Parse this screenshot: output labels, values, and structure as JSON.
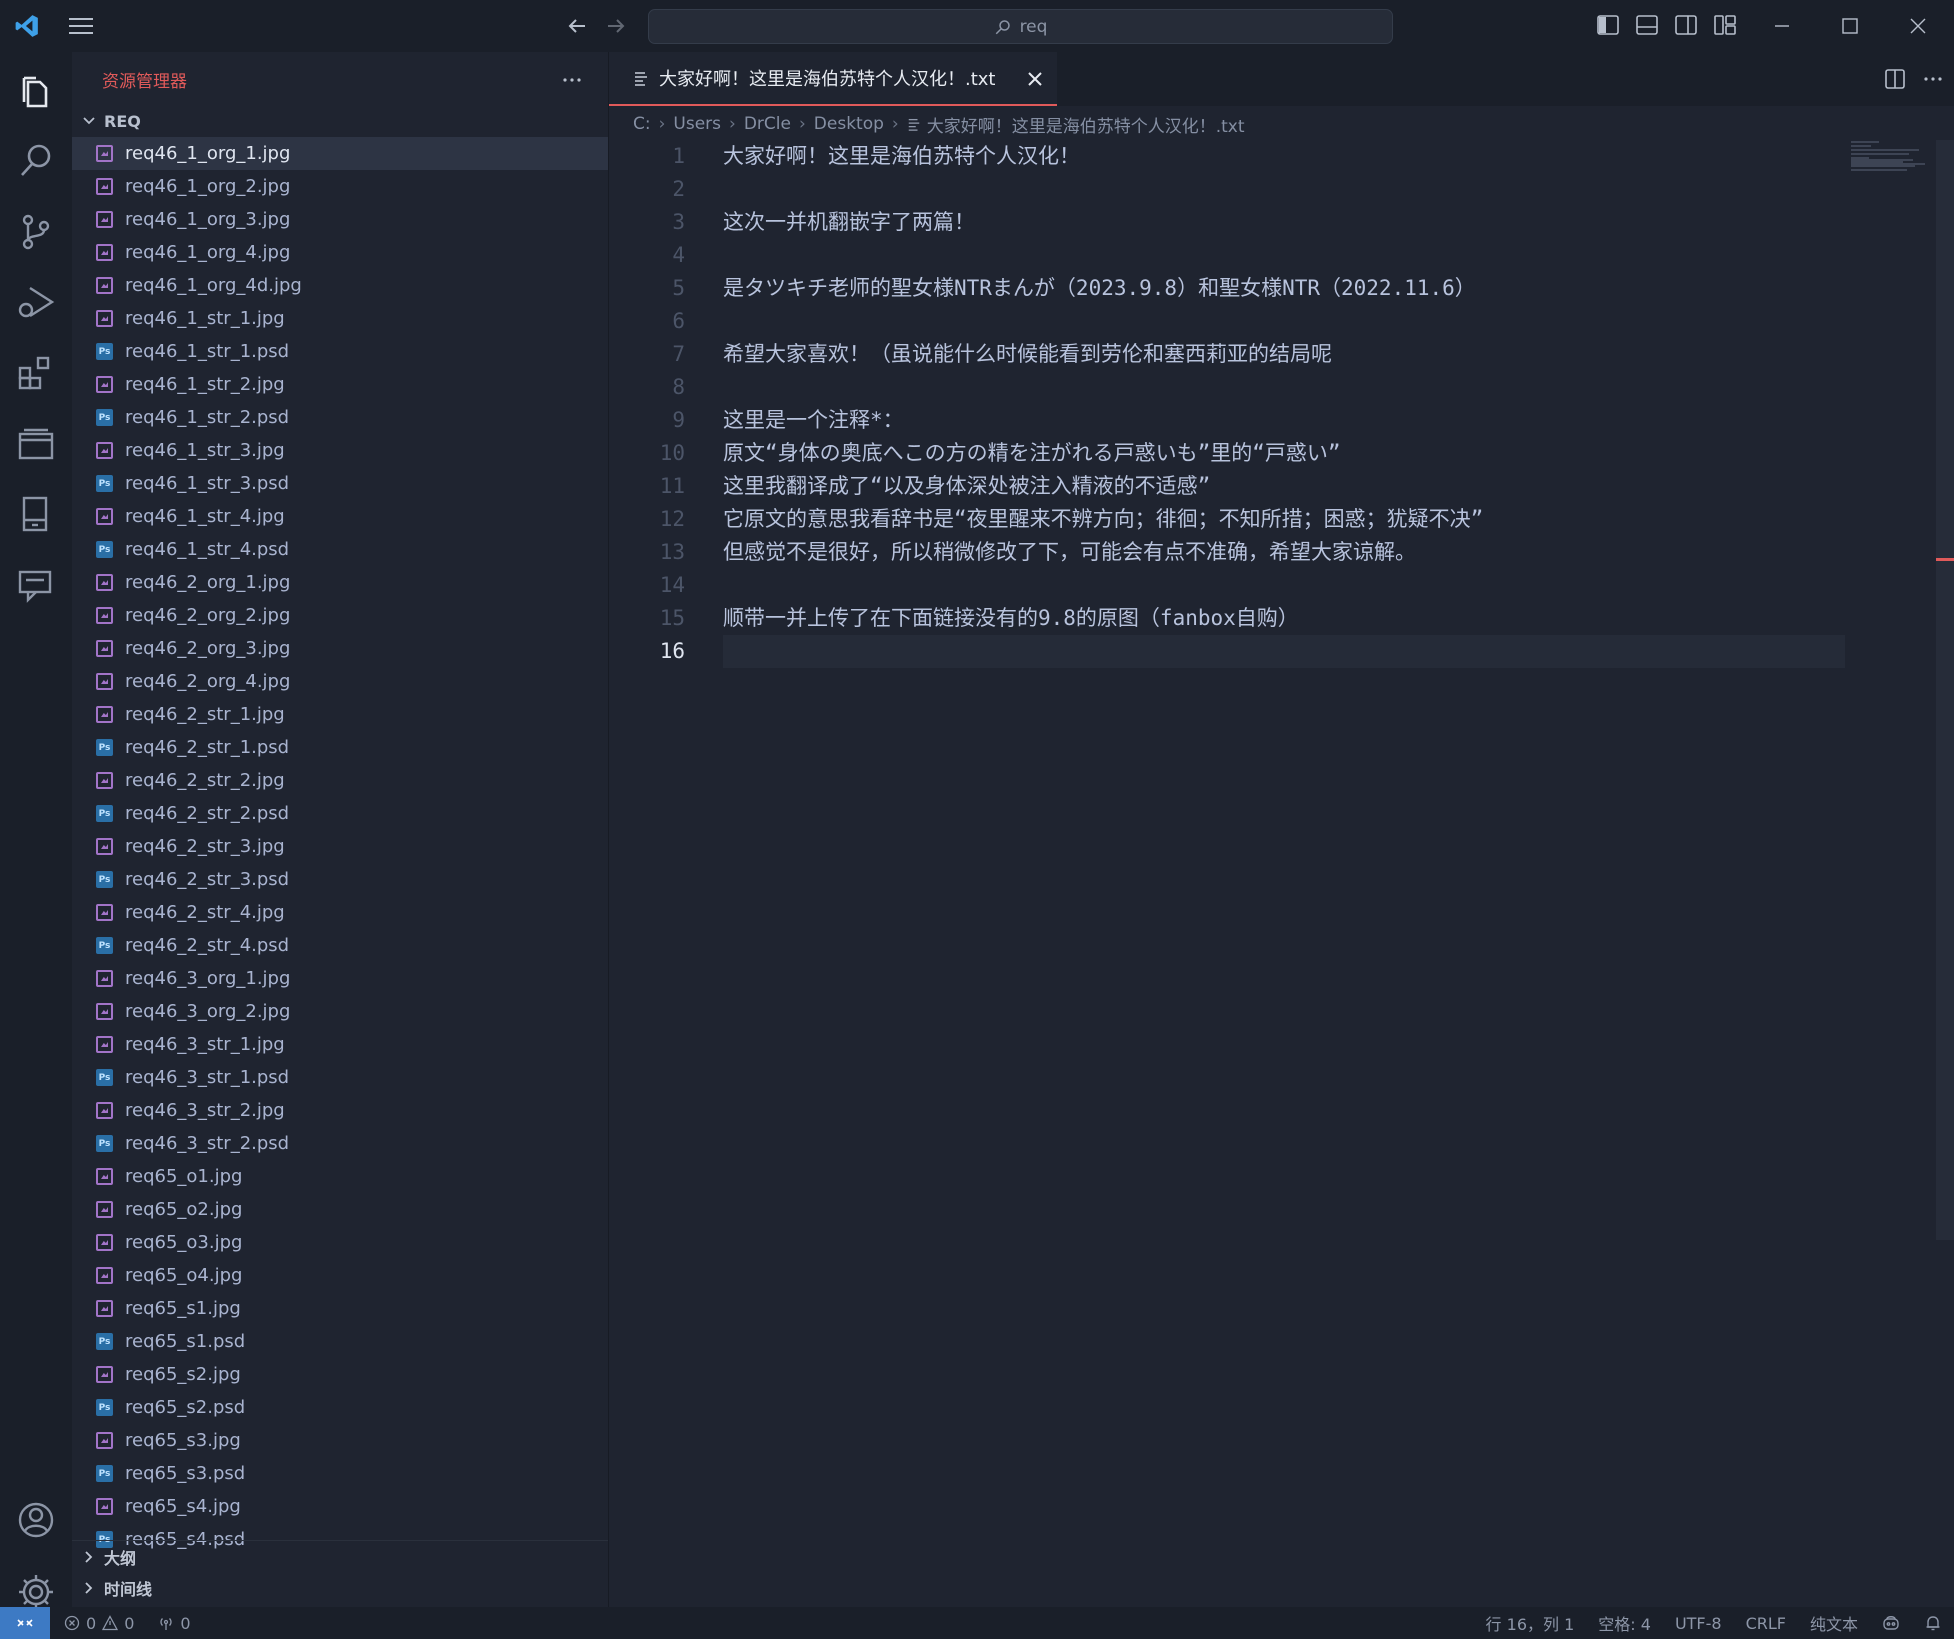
{
  "titlebar": {
    "search_text": "req"
  },
  "colors": {
    "accent_red": "#e05a5a",
    "remote_blue": "#3d7ac4",
    "image_icon": "#a274c8",
    "psd_icon": "#2a6fa6"
  },
  "activity_bar": {
    "items": [
      "explorer-icon",
      "search-icon",
      "source-control-icon",
      "run-debug-icon",
      "extensions-icon",
      "remote-explorer-icon",
      "notebook-icon",
      "chat-icon"
    ],
    "bottom": [
      "account-icon",
      "settings-gear-icon"
    ]
  },
  "sidebar": {
    "title": "资源管理器",
    "folder": "REQ",
    "files": [
      {
        "name": "req46_1_org_1.jpg",
        "type": "img"
      },
      {
        "name": "req46_1_org_2.jpg",
        "type": "img"
      },
      {
        "name": "req46_1_org_3.jpg",
        "type": "img"
      },
      {
        "name": "req46_1_org_4.jpg",
        "type": "img"
      },
      {
        "name": "req46_1_org_4d.jpg",
        "type": "img"
      },
      {
        "name": "req46_1_str_1.jpg",
        "type": "img"
      },
      {
        "name": "req46_1_str_1.psd",
        "type": "psd"
      },
      {
        "name": "req46_1_str_2.jpg",
        "type": "img"
      },
      {
        "name": "req46_1_str_2.psd",
        "type": "psd"
      },
      {
        "name": "req46_1_str_3.jpg",
        "type": "img"
      },
      {
        "name": "req46_1_str_3.psd",
        "type": "psd"
      },
      {
        "name": "req46_1_str_4.jpg",
        "type": "img"
      },
      {
        "name": "req46_1_str_4.psd",
        "type": "psd"
      },
      {
        "name": "req46_2_org_1.jpg",
        "type": "img"
      },
      {
        "name": "req46_2_org_2.jpg",
        "type": "img"
      },
      {
        "name": "req46_2_org_3.jpg",
        "type": "img"
      },
      {
        "name": "req46_2_org_4.jpg",
        "type": "img"
      },
      {
        "name": "req46_2_str_1.jpg",
        "type": "img"
      },
      {
        "name": "req46_2_str_1.psd",
        "type": "psd"
      },
      {
        "name": "req46_2_str_2.jpg",
        "type": "img"
      },
      {
        "name": "req46_2_str_2.psd",
        "type": "psd"
      },
      {
        "name": "req46_2_str_3.jpg",
        "type": "img"
      },
      {
        "name": "req46_2_str_3.psd",
        "type": "psd"
      },
      {
        "name": "req46_2_str_4.jpg",
        "type": "img"
      },
      {
        "name": "req46_2_str_4.psd",
        "type": "psd"
      },
      {
        "name": "req46_3_org_1.jpg",
        "type": "img"
      },
      {
        "name": "req46_3_org_2.jpg",
        "type": "img"
      },
      {
        "name": "req46_3_str_1.jpg",
        "type": "img"
      },
      {
        "name": "req46_3_str_1.psd",
        "type": "psd"
      },
      {
        "name": "req46_3_str_2.jpg",
        "type": "img"
      },
      {
        "name": "req46_3_str_2.psd",
        "type": "psd"
      },
      {
        "name": "req65_o1.jpg",
        "type": "img"
      },
      {
        "name": "req65_o2.jpg",
        "type": "img"
      },
      {
        "name": "req65_o3.jpg",
        "type": "img"
      },
      {
        "name": "req65_o4.jpg",
        "type": "img"
      },
      {
        "name": "req65_s1.jpg",
        "type": "img"
      },
      {
        "name": "req65_s1.psd",
        "type": "psd"
      },
      {
        "name": "req65_s2.jpg",
        "type": "img"
      },
      {
        "name": "req65_s2.psd",
        "type": "psd"
      },
      {
        "name": "req65_s3.jpg",
        "type": "img"
      },
      {
        "name": "req65_s3.psd",
        "type": "psd"
      },
      {
        "name": "req65_s4.jpg",
        "type": "img"
      },
      {
        "name": "req65_s4.psd",
        "type": "psd"
      }
    ],
    "selected_index": 0,
    "outline_label": "大纲",
    "timeline_label": "时间线",
    "psd_badge": "Ps"
  },
  "editor": {
    "tab_title": "大家好啊！这里是海伯苏特个人汉化！.txt",
    "breadcrumb": [
      "C:",
      "Users",
      "DrCle",
      "Desktop",
      "大家好啊！这里是海伯苏特个人汉化！.txt"
    ],
    "current_line": 16,
    "lines": [
      "大家好啊！这里是海伯苏特个人汉化！",
      "",
      "这次一并机翻嵌字了两篇！",
      "",
      "是タツキチ老师的聖女様NTRまんが（2023.9.8）和聖女様NTR（2022.11.6）",
      "",
      "希望大家喜欢！（虽说能什么时候能看到劳伦和塞西莉亚的结局呢",
      "",
      "这里是一个注释*：",
      "原文“身体の奥底へこの方の精を注がれる戸惑いも”里的“戸惑い”",
      "这里我翻译成了“以及身体深处被注入精液的不适感”",
      "它原文的意思我看辞书是“夜里醒来不辨方向；徘徊；不知所措；困惑；犹疑不决”",
      "但感觉不是很好，所以稍微修改了下，可能会有点不准确，希望大家谅解。",
      "",
      "顺带一并上传了在下面链接没有的9.8的原图（fanbox自购）",
      ""
    ]
  },
  "statusbar": {
    "errors": "0",
    "warnings": "0",
    "ports": "0",
    "position": "行 16，列 1",
    "indent": "空格: 4",
    "encoding": "UTF-8",
    "eol": "CRLF",
    "language": "纯文本"
  }
}
